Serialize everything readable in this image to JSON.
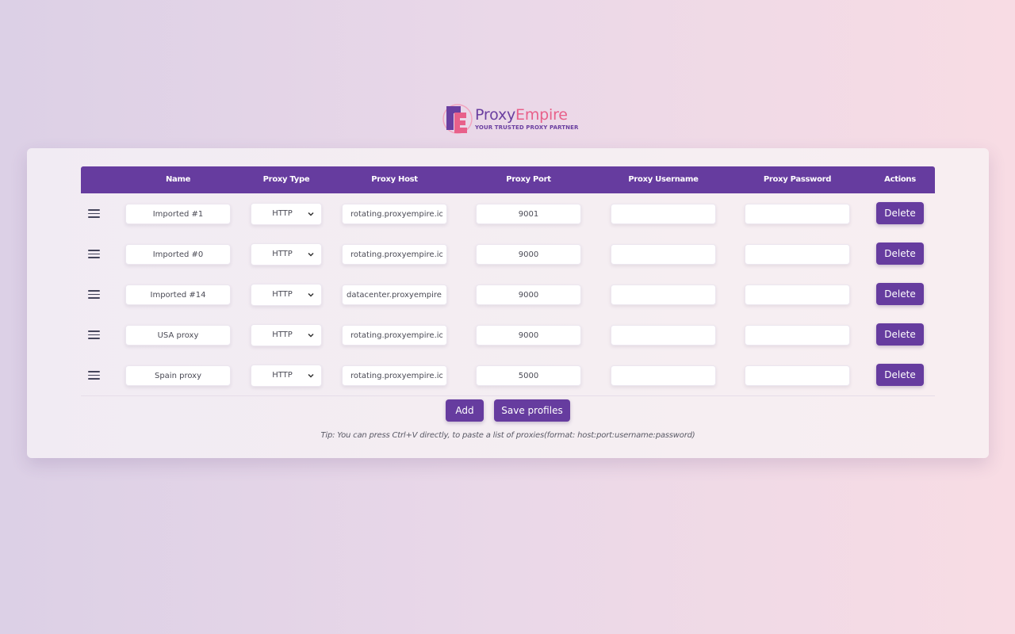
{
  "brand": {
    "name_part1": "Proxy",
    "name_part2": "Empire",
    "tagline": "YOUR TRUSTED PROXY PARTNER"
  },
  "table": {
    "headers": {
      "name": "Name",
      "type": "Proxy Type",
      "host": "Proxy Host",
      "port": "Proxy Port",
      "username": "Proxy Username",
      "password": "Proxy Password",
      "actions": "Actions"
    },
    "rows": [
      {
        "name": "Imported #1",
        "type": "HTTP",
        "host": "rotating.proxyempire.io",
        "port": "9001",
        "username": "",
        "password": "",
        "delete_label": "Delete"
      },
      {
        "name": "Imported #0",
        "type": "HTTP",
        "host": "rotating.proxyempire.io",
        "port": "9000",
        "username": "",
        "password": "",
        "delete_label": "Delete"
      },
      {
        "name": "Imported #14",
        "type": "HTTP",
        "host": "datacenter.proxyempire.io",
        "port": "9000",
        "username": "",
        "password": "",
        "delete_label": "Delete"
      },
      {
        "name": "USA proxy",
        "type": "HTTP",
        "host": "rotating.proxyempire.io",
        "port": "9000",
        "username": "",
        "password": "",
        "delete_label": "Delete"
      },
      {
        "name": "Spain proxy",
        "type": "HTTP",
        "host": "rotating.proxyempire.io",
        "port": "5000",
        "username": "",
        "password": "",
        "delete_label": "Delete"
      }
    ]
  },
  "actions": {
    "add_label": "Add",
    "save_label": "Save profiles"
  },
  "tip": "Tip: You can press Ctrl+V directly, to paste a list of proxies(format: host:port:username:password)",
  "colors": {
    "accent": "#663c9f",
    "brand_pink": "#e8608a"
  }
}
